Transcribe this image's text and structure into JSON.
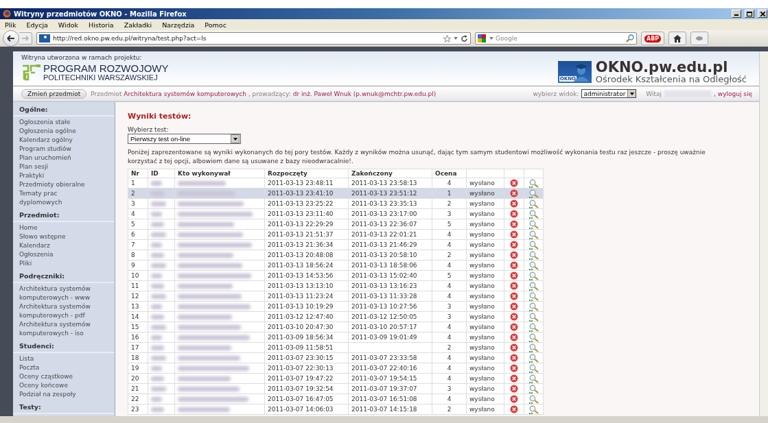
{
  "window": {
    "title": "Witryny przedmiotów OKNO - Mozilla Firefox"
  },
  "menu": [
    "Plik",
    "Edycja",
    "Widok",
    "Historia",
    "Zakładki",
    "Narzędzia",
    "Pomoc"
  ],
  "toolbar": {
    "url": "http://red.okno.pw.edu.pl/witryna/test.php?act=ls",
    "search_placeholder": "Google",
    "abp_label": "ABP"
  },
  "header": {
    "project_note": "Witryna utworzona w ramach projektu:",
    "program_line1": "PROGRAM ROZWOJOWY",
    "program_line2": "POLITECHNIKI WARSZAWSKIEJ",
    "okno_logo_text": "OKNO",
    "site_title": "OKNO.pw.edu.pl",
    "site_subtitle": "Ośrodek Kształcenia na Odległość"
  },
  "subject_bar": {
    "change_button": "Zmień przedmiot",
    "subject_label": "Przedmiot",
    "subject_name": "Architektura systemów komputerowych",
    "teacher_label": ", prowadzący:",
    "teacher_name": "dr inż. Paweł Wnuk (p.wnuk@mchtr.pw.edu.pl)",
    "view_label": "wybierz widok:",
    "view_value": "administrator",
    "greeting": "Witaj",
    "logout": ", wyloguj się"
  },
  "sidebar": [
    {
      "heading": "Ogólne:",
      "items": [
        "Ogłoszenia stałe",
        "Ogłoszenia ogólne",
        "Kalendarz ogólny",
        "Program studiów",
        "Plan uruchomień",
        "Plan sesji",
        "Praktyki",
        "Przedmioty obieralne",
        "Tematy prac dyplomowych"
      ]
    },
    {
      "heading": "Przedmiot:",
      "items": [
        "Home",
        "Słowo wstępne",
        "Kalendarz",
        "Ogłoszenia",
        "Pliki"
      ]
    },
    {
      "heading": "Podręczniki:",
      "items": [
        "Architektura systemów komputerowych - www",
        "Architektura systemów komputerowych - pdf",
        "Architektura systemów komputerowych - iso"
      ]
    },
    {
      "heading": "Studenci:",
      "items": [
        "Lista",
        "Poczta",
        "Oceny cząstkowe",
        "Oceny końcowe",
        "Podział na zespoły"
      ]
    },
    {
      "heading": "Testy:"
    }
  ],
  "main": {
    "title": "Wyniki testów:",
    "select_label": "Wybierz test:",
    "select_value": "Pierwszy test on-line",
    "description": "Poniżej zaprezentowane są wyniki wykonanych do tej pory testów. Każdy z wyników można usunąć, dając tym samym studentowi możliwość wykonania testu raz jeszcze - proszę uważnie korzystać z tej opcji, albowiem dane są usuwane z bazy nieodwracalnie!."
  },
  "table": {
    "columns": [
      "Nr",
      "ID",
      "Kto wykonywał",
      "Rozpoczęty",
      "Zakończony",
      "Ocena"
    ],
    "rows": [
      {
        "nr": "1",
        "start": "2011-03-13 23:48:11",
        "end": "2011-03-13 23:58:13",
        "grade": "4",
        "status": "wysłano",
        "selected": false
      },
      {
        "nr": "2",
        "start": "2011-03-13 23:41:10",
        "end": "2011-03-13 23:51:12",
        "grade": "1",
        "status": "wysłano",
        "selected": true
      },
      {
        "nr": "3",
        "start": "2011-03-13 23:25:22",
        "end": "2011-03-13 23:35:13",
        "grade": "2",
        "status": "wysłano",
        "selected": false
      },
      {
        "nr": "4",
        "start": "2011-03-13 23:11:40",
        "end": "2011-03-13 23:17:00",
        "grade": "3",
        "status": "wysłano",
        "selected": false
      },
      {
        "nr": "5",
        "start": "2011-03-13 22:29:29",
        "end": "2011-03-13 22:36:07",
        "grade": "5",
        "status": "wysłano",
        "selected": false
      },
      {
        "nr": "6",
        "start": "2011-03-13 21:51:37",
        "end": "2011-03-13 22:01:21",
        "grade": "4",
        "status": "wysłano",
        "selected": false
      },
      {
        "nr": "7",
        "start": "2011-03-13 21:36:34",
        "end": "2011-03-13 21:46:29",
        "grade": "4",
        "status": "wysłano",
        "selected": false
      },
      {
        "nr": "8",
        "start": "2011-03-13 20:48:08",
        "end": "2011-03-13 20:58:10",
        "grade": "2",
        "status": "wysłano",
        "selected": false
      },
      {
        "nr": "9",
        "start": "2011-03-13 18:56:24",
        "end": "2011-03-13 18:58:06",
        "grade": "4",
        "status": "wysłano",
        "selected": false
      },
      {
        "nr": "10",
        "start": "2011-03-13 14:53:56",
        "end": "2011-03-13 15:02:40",
        "grade": "5",
        "status": "wysłano",
        "selected": false
      },
      {
        "nr": "11",
        "start": "2011-03-13 13:13:10",
        "end": "2011-03-13 13:16:23",
        "grade": "4",
        "status": "wysłano",
        "selected": false
      },
      {
        "nr": "12",
        "start": "2011-03-13 11:23:24",
        "end": "2011-03-13 11:33:28",
        "grade": "4",
        "status": "wysłano",
        "selected": false
      },
      {
        "nr": "13",
        "start": "2011-03-13 10:19:29",
        "end": "2011-03-13 10:27:56",
        "grade": "3",
        "status": "wysłano",
        "selected": false
      },
      {
        "nr": "14",
        "start": "2011-03-12 12:47:40",
        "end": "2011-03-12 12:50:05",
        "grade": "3",
        "status": "wysłano",
        "selected": false
      },
      {
        "nr": "15",
        "start": "2011-03-10 20:47:30",
        "end": "2011-03-10 20:57:17",
        "grade": "4",
        "status": "wysłano",
        "selected": false
      },
      {
        "nr": "16",
        "start": "2011-03-09 18:56:34",
        "end": "2011-03-09 19:01:49",
        "grade": "4",
        "status": "wysłano",
        "selected": false
      },
      {
        "nr": "17",
        "start": "2011-03-09 11:58:51",
        "grade": "2",
        "status": "wysłano",
        "selected": false
      },
      {
        "nr": "18",
        "start": "2011-03-07 23:30:15",
        "end": "2011-03-07 23:33:58",
        "grade": "4",
        "status": "wysłano",
        "selected": false
      },
      {
        "nr": "19",
        "start": "2011-03-07 22:30:13",
        "end": "2011-03-07 22:40:16",
        "grade": "4",
        "status": "wysłano",
        "selected": false
      },
      {
        "nr": "20",
        "start": "2011-03-07 19:47:22",
        "end": "2011-03-07 19:54:15",
        "grade": "4",
        "status": "wysłano",
        "selected": false
      },
      {
        "nr": "21",
        "start": "2011-03-07 19:32:54",
        "end": "2011-03-07 19:37:07",
        "grade": "3",
        "status": "wysłano",
        "selected": false
      },
      {
        "nr": "22",
        "start": "2011-03-07 16:47:05",
        "end": "2011-03-07 16:51:08",
        "grade": "4",
        "status": "wysłano",
        "selected": false
      },
      {
        "nr": "23",
        "start": "2011-03-07 14:06:03",
        "end": "2011-03-07 14:15:18",
        "grade": "2",
        "status": "wysłano",
        "selected": false
      }
    ]
  }
}
